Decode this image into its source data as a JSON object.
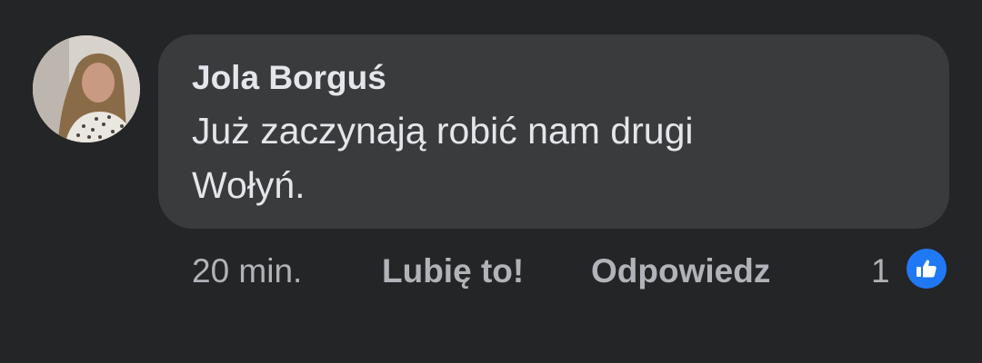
{
  "comment": {
    "author": "Jola Borguś",
    "text": "Już zaczynają robić nam drugi Wołyń.",
    "avatar_icon": "profile-photo",
    "bubble_color": "#3a3b3c"
  },
  "actions": {
    "time": "20 min.",
    "like_label": "Lubię to!",
    "reply_label": "Odpowiedz",
    "reaction_count": "1",
    "reaction_icon": "thumbs-up-icon",
    "reaction_color": "#2078f4"
  }
}
